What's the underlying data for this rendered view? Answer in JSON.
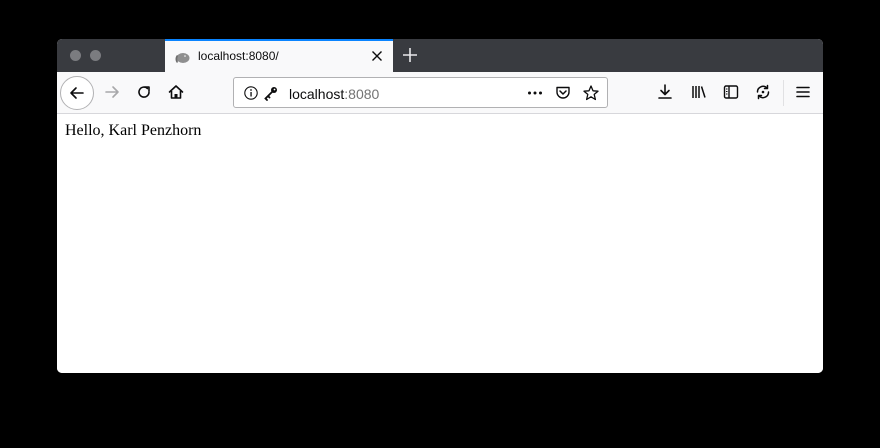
{
  "window": {
    "controls": [
      "close",
      "minimize"
    ]
  },
  "tab": {
    "title": "localhost:8080/",
    "favicon": "elephant-favicon-icon"
  },
  "toolbar": {
    "back": "back-arrow-icon",
    "forward": "forward-arrow-icon",
    "reload": "reload-icon",
    "home": "home-icon",
    "downloads": "download-icon",
    "library": "library-icon",
    "sidebar": "sidebar-icon",
    "sync": "sync-icon",
    "menu": "hamburger-menu-icon"
  },
  "urlbar": {
    "host": "localhost",
    "port": ":8080",
    "icons": [
      "info-icon",
      "key-icon",
      "page-actions-icon",
      "pocket-icon",
      "bookmark-star-icon"
    ]
  },
  "page": {
    "greeting": "Hello, Karl Penzhorn"
  },
  "colors": {
    "tabbar": "#393b40",
    "accent": "#0a84ff",
    "toolbar": "#f9f9fa"
  }
}
